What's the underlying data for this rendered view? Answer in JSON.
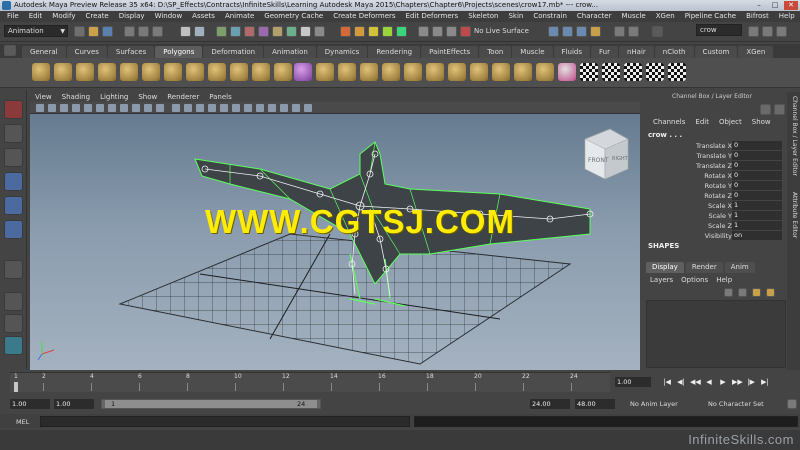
{
  "window": {
    "title": "Autodesk Maya Preview Release 35 x64: D:\\SP_Effects\\Contracts\\InfiniteSkills\\Learning Autodesk Maya 2015\\Chapters\\Chapter6\\Projects\\scenes\\crow17.mb* --- crow...",
    "minimize": "–",
    "maximize": "□",
    "close": "✕"
  },
  "menubar": [
    "File",
    "Edit",
    "Modify",
    "Create",
    "Display",
    "Window",
    "Assets",
    "Animate",
    "Geometry Cache",
    "Create Deformers",
    "Edit Deformers",
    "Skeleton",
    "Skin",
    "Constrain",
    "Character",
    "Muscle",
    "XGen",
    "Pipeline Cache",
    "Bifrost",
    "Help"
  ],
  "statusline": {
    "mode": "Animation",
    "live_surface": "No Live Surface",
    "search": "crow"
  },
  "shelf": {
    "tabs": [
      "General",
      "Curves",
      "Surfaces",
      "Polygons",
      "Deformation",
      "Animation",
      "Dynamics",
      "Rendering",
      "PaintEffects",
      "Toon",
      "Muscle",
      "Fluids",
      "Fur",
      "nHair",
      "nCloth",
      "Custom",
      "XGen"
    ],
    "active_tab": "Polygons"
  },
  "viewport": {
    "menu": [
      "View",
      "Shading",
      "Lighting",
      "Show",
      "Renderer",
      "Panels"
    ],
    "viewcube_front": "FRONT",
    "viewcube_right": "RIGHT",
    "watermark": "WWW.CGTSJ.COM"
  },
  "channel_box": {
    "header": "Channel Box / Layer Editor",
    "menu": [
      "Channels",
      "Edit",
      "Object",
      "Show"
    ],
    "object": "crow . . .",
    "attributes": [
      {
        "label": "Translate X",
        "value": "0"
      },
      {
        "label": "Translate Y",
        "value": "0"
      },
      {
        "label": "Translate Z",
        "value": "0"
      },
      {
        "label": "Rotate X",
        "value": "0"
      },
      {
        "label": "Rotate Y",
        "value": "0"
      },
      {
        "label": "Rotate Z",
        "value": "0"
      },
      {
        "label": "Scale X",
        "value": "1"
      },
      {
        "label": "Scale Y",
        "value": "1"
      },
      {
        "label": "Scale Z",
        "value": "1"
      },
      {
        "label": "Visibility",
        "value": "on"
      }
    ],
    "shapes": "SHAPES",
    "layer_tabs": [
      "Display",
      "Render",
      "Anim"
    ],
    "layer_menu": [
      "Layers",
      "Options",
      "Help"
    ],
    "side_tabs": [
      "Channel Box / Layer Editor",
      "Attribute Editor"
    ]
  },
  "timeslider": {
    "ticks": [
      "1",
      "2",
      "4",
      "6",
      "8",
      "10",
      "12",
      "14",
      "16",
      "18",
      "20",
      "22",
      "24"
    ],
    "current_frame": "1.00"
  },
  "playback": [
    "|◀",
    "◀|",
    "◀◀",
    "◀",
    "▶",
    "▶▶",
    "|▶",
    "▶|"
  ],
  "range": {
    "start": "1.00",
    "playback_start": "1.00",
    "handle_start": "1",
    "handle_end": "24",
    "playback_end": "24.00",
    "end": "48.00",
    "anim_layer": "No Anim Layer",
    "character_set": "No Character Set"
  },
  "command_line": {
    "label": "MEL"
  },
  "branding": "InfiniteSkills.com"
}
